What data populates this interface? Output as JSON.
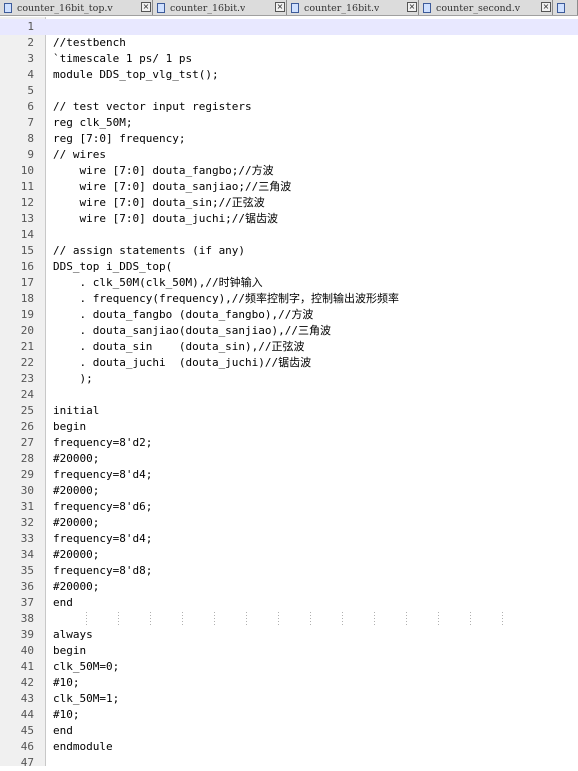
{
  "tabs": [
    {
      "label": "counter_16bit_top.v"
    },
    {
      "label": "counter_16bit.v"
    },
    {
      "label": "counter_16bit.v"
    },
    {
      "label": "counter_second.v"
    }
  ],
  "lines": [
    {
      "n": "1",
      "text": ""
    },
    {
      "n": "2",
      "text": "//testbench"
    },
    {
      "n": "3",
      "text": "`timescale 1 ps/ 1 ps"
    },
    {
      "n": "4",
      "text": "module DDS_top_vlg_tst();"
    },
    {
      "n": "5",
      "text": ""
    },
    {
      "n": "6",
      "text": "// test vector input registers"
    },
    {
      "n": "7",
      "text": "reg clk_50M;"
    },
    {
      "n": "8",
      "text": "reg [7:0] frequency;"
    },
    {
      "n": "9",
      "text": "// wires"
    },
    {
      "n": "10",
      "text": "    wire [7:0] douta_fangbo;//方波"
    },
    {
      "n": "11",
      "text": "    wire [7:0] douta_sanjiao;//三角波"
    },
    {
      "n": "12",
      "text": "    wire [7:0] douta_sin;//正弦波"
    },
    {
      "n": "13",
      "text": "    wire [7:0] douta_juchi;//锯齿波"
    },
    {
      "n": "14",
      "text": ""
    },
    {
      "n": "15",
      "text": "// assign statements (if any)"
    },
    {
      "n": "16",
      "text": "DDS_top i_DDS_top("
    },
    {
      "n": "17",
      "text": "    . clk_50M(clk_50M),//时钟输入"
    },
    {
      "n": "18",
      "text": "    . frequency(frequency),//频率控制字，控制输出波形频率"
    },
    {
      "n": "19",
      "text": "    . douta_fangbo (douta_fangbo),//方波"
    },
    {
      "n": "20",
      "text": "    . douta_sanjiao(douta_sanjiao),//三角波"
    },
    {
      "n": "21",
      "text": "    . douta_sin    (douta_sin),//正弦波"
    },
    {
      "n": "22",
      "text": "    . douta_juchi  (douta_juchi)//锯齿波"
    },
    {
      "n": "23",
      "text": "    );"
    },
    {
      "n": "24",
      "text": ""
    },
    {
      "n": "25",
      "text": "initial"
    },
    {
      "n": "26",
      "text": "begin"
    },
    {
      "n": "27",
      "text": "frequency=8'd2;"
    },
    {
      "n": "28",
      "text": "#20000;"
    },
    {
      "n": "29",
      "text": "frequency=8'd4;"
    },
    {
      "n": "30",
      "text": "#20000;"
    },
    {
      "n": "31",
      "text": "frequency=8'd6;"
    },
    {
      "n": "32",
      "text": "#20000;"
    },
    {
      "n": "33",
      "text": "frequency=8'd4;"
    },
    {
      "n": "34",
      "text": "#20000;"
    },
    {
      "n": "35",
      "text": "frequency=8'd8;"
    },
    {
      "n": "36",
      "text": "#20000;"
    },
    {
      "n": "37",
      "text": "end"
    },
    {
      "n": "38",
      "text": ""
    },
    {
      "n": "39",
      "text": "always"
    },
    {
      "n": "40",
      "text": "begin"
    },
    {
      "n": "41",
      "text": "clk_50M=0;"
    },
    {
      "n": "42",
      "text": "#10;"
    },
    {
      "n": "43",
      "text": "clk_50M=1;"
    },
    {
      "n": "44",
      "text": "#10;"
    },
    {
      "n": "45",
      "text": "end"
    },
    {
      "n": "46",
      "text": "endmodule"
    },
    {
      "n": "47",
      "text": ""
    }
  ]
}
